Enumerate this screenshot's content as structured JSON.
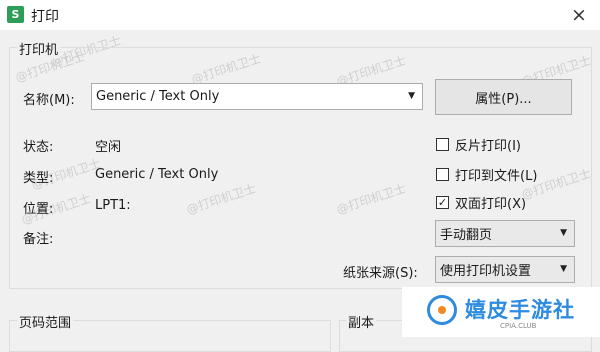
{
  "window": {
    "app_icon": "S",
    "title": "打印",
    "close_icon": "×"
  },
  "printer": {
    "group_title": "打印机",
    "name_label": "名称(M):",
    "name_value": "Generic / Text Only",
    "properties_button": "属性(P)...",
    "status_label": "状态:",
    "status_value": "空闲",
    "type_label": "类型:",
    "type_value": "Generic / Text Only",
    "location_label": "位置:",
    "location_value": "LPT1:",
    "comment_label": "备注:",
    "reverse_print": {
      "label": "反片打印(I)",
      "checked": false
    },
    "print_to_file": {
      "label": "打印到文件(L)",
      "checked": false
    },
    "duplex": {
      "label": "双面打印(X)",
      "checked": true
    },
    "duplex_mode": "手动翻页",
    "paper_source_label": "纸张来源(S):",
    "paper_source_value": "使用打印机设置"
  },
  "page_range": {
    "group_title": "页码范围"
  },
  "copies": {
    "group_title": "副本"
  },
  "watermarks": [
    "@打印机卫士",
    "@打印机卫士",
    "@打印机卫士",
    "@打印机卫士",
    "@打印机卫士",
    "@打印机卫士",
    "@打印机卫士",
    "@打印机卫士",
    "@打印机卫士",
    "@打印机卫士"
  ],
  "branding": {
    "name": "嬉皮手游社",
    "sub": "CPIA.CLUB"
  },
  "colors": {
    "app_icon_bg": "#2e9d57",
    "logo_blue": "#2d8be0",
    "logo_orange": "#f08a1e"
  }
}
